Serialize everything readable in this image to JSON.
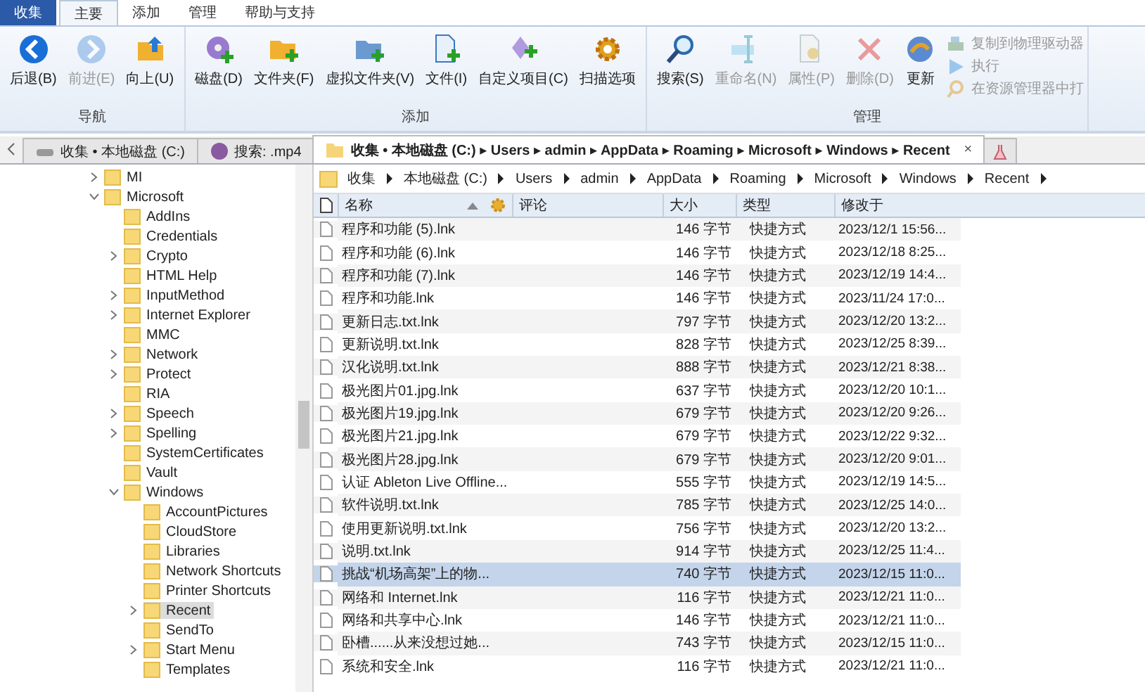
{
  "app_menu": {
    "label": "收集"
  },
  "ribbon_tabs": [
    {
      "label": "主要",
      "selected": true
    },
    {
      "label": "添加",
      "selected": false
    },
    {
      "label": "管理",
      "selected": false
    },
    {
      "label": "帮助与支持",
      "selected": false
    }
  ],
  "ribbon_groups": [
    {
      "label": "导航",
      "buttons": [
        {
          "label": "后退(B)",
          "disabled": false
        },
        {
          "label": "前进(E)",
          "disabled": true
        },
        {
          "label": "向上(U)",
          "disabled": false
        }
      ]
    },
    {
      "label": "添加",
      "buttons": [
        {
          "label": "磁盘(D)",
          "disabled": false
        },
        {
          "label": "文件夹(F)",
          "disabled": false
        },
        {
          "label": "虚拟文件夹(V)",
          "disabled": false
        },
        {
          "label": "文件(I)",
          "disabled": false
        },
        {
          "label": "自定义项目(C)",
          "disabled": false
        },
        {
          "label": "扫描选项",
          "disabled": false
        }
      ]
    },
    {
      "label": "管理",
      "buttons": [
        {
          "label": "搜索(S)",
          "disabled": false
        },
        {
          "label": "重命名(N)",
          "disabled": true
        },
        {
          "label": "属性(P)",
          "disabled": true
        },
        {
          "label": "删除(D)",
          "disabled": true
        },
        {
          "label": "更新",
          "disabled": false
        }
      ],
      "small_buttons": [
        {
          "label": "复制到物理驱动器",
          "disabled": true
        },
        {
          "label": "执行",
          "disabled": true
        },
        {
          "label": "在资源管理器中打",
          "disabled": true
        }
      ]
    }
  ],
  "document_tabs": [
    {
      "label": "收集 • 本地磁盘 (C:)",
      "selected": false
    },
    {
      "label": "搜索: .mp4",
      "selected": false
    },
    {
      "label": "收集 • 本地磁盘 (C:) ▸ Users ▸ admin ▸ AppData ▸ Roaming ▸ Microsoft ▸ Windows ▸ Recent",
      "selected": true,
      "close": "×"
    }
  ],
  "breadcrumb": [
    "收集",
    "本地磁盘 (C:)",
    "Users",
    "admin",
    "AppData",
    "Roaming",
    "Microsoft",
    "Windows",
    "Recent"
  ],
  "tree": [
    {
      "label": "MI",
      "expanded": false,
      "selected": false
    },
    {
      "label": "Microsoft",
      "expanded": true,
      "selected": false,
      "children": [
        {
          "label": "AddIns",
          "selected": false
        },
        {
          "label": "Credentials",
          "selected": false
        },
        {
          "label": "Crypto",
          "expanded": false,
          "selected": false
        },
        {
          "label": "HTML Help",
          "selected": false
        },
        {
          "label": "InputMethod",
          "expanded": false,
          "selected": false
        },
        {
          "label": "Internet Explorer",
          "expanded": false,
          "selected": false
        },
        {
          "label": "MMC",
          "selected": false
        },
        {
          "label": "Network",
          "expanded": false,
          "selected": false
        },
        {
          "label": "Protect",
          "expanded": false,
          "selected": false
        },
        {
          "label": "RIA",
          "selected": false
        },
        {
          "label": "Speech",
          "expanded": false,
          "selected": false
        },
        {
          "label": "Spelling",
          "expanded": false,
          "selected": false
        },
        {
          "label": "SystemCertificates",
          "selected": false
        },
        {
          "label": "Vault",
          "selected": false
        },
        {
          "label": "Windows",
          "expanded": true,
          "selected": false,
          "children": [
            {
              "label": "AccountPictures",
              "selected": false
            },
            {
              "label": "CloudStore",
              "selected": false
            },
            {
              "label": "Libraries",
              "selected": false
            },
            {
              "label": "Network Shortcuts",
              "selected": false
            },
            {
              "label": "Printer Shortcuts",
              "selected": false
            },
            {
              "label": "Recent",
              "expanded": false,
              "selected": true
            },
            {
              "label": "SendTo",
              "selected": false
            },
            {
              "label": "Start Menu",
              "expanded": false,
              "selected": false
            },
            {
              "label": "Templates",
              "selected": false
            }
          ]
        }
      ]
    }
  ],
  "file_list": {
    "columns": [
      {
        "label": "名称",
        "sorted": true
      },
      {
        "label": "评论",
        "sorted": false
      },
      {
        "label": "大小",
        "sorted": false
      },
      {
        "label": "类型",
        "sorted": false
      },
      {
        "label": "修改于",
        "sorted": false
      }
    ],
    "rows": [
      {
        "name": "程序和功能 (5).lnk",
        "size": "146 字节",
        "type": "快捷方式",
        "modified": "2023/12/1 15:56...",
        "selected": false
      },
      {
        "name": "程序和功能 (6).lnk",
        "size": "146 字节",
        "type": "快捷方式",
        "modified": "2023/12/18 8:25...",
        "selected": false
      },
      {
        "name": "程序和功能 (7).lnk",
        "size": "146 字节",
        "type": "快捷方式",
        "modified": "2023/12/19 14:4...",
        "selected": false
      },
      {
        "name": "程序和功能.lnk",
        "size": "146 字节",
        "type": "快捷方式",
        "modified": "2023/11/24 17:0...",
        "selected": false
      },
      {
        "name": "更新日志.txt.lnk",
        "size": "797 字节",
        "type": "快捷方式",
        "modified": "2023/12/20 13:2...",
        "selected": false
      },
      {
        "name": "更新说明.txt.lnk",
        "size": "828 字节",
        "type": "快捷方式",
        "modified": "2023/12/25 8:39...",
        "selected": false
      },
      {
        "name": "汉化说明.txt.lnk",
        "size": "888 字节",
        "type": "快捷方式",
        "modified": "2023/12/21 8:38...",
        "selected": false
      },
      {
        "name": "极光图片01.jpg.lnk",
        "size": "637 字节",
        "type": "快捷方式",
        "modified": "2023/12/20 10:1...",
        "selected": false
      },
      {
        "name": "极光图片19.jpg.lnk",
        "size": "679 字节",
        "type": "快捷方式",
        "modified": "2023/12/20 9:26...",
        "selected": false
      },
      {
        "name": "极光图片21.jpg.lnk",
        "size": "679 字节",
        "type": "快捷方式",
        "modified": "2023/12/22 9:32...",
        "selected": false
      },
      {
        "name": "极光图片28.jpg.lnk",
        "size": "679 字节",
        "type": "快捷方式",
        "modified": "2023/12/20 9:01...",
        "selected": false
      },
      {
        "name": "认证 Ableton Live Offline...",
        "size": "555 字节",
        "type": "快捷方式",
        "modified": "2023/12/19 14:5...",
        "selected": false
      },
      {
        "name": "软件说明.txt.lnk",
        "size": "785 字节",
        "type": "快捷方式",
        "modified": "2023/12/25 14:0...",
        "selected": false
      },
      {
        "name": "使用更新说明.txt.lnk",
        "size": "756 字节",
        "type": "快捷方式",
        "modified": "2023/12/20 13:2...",
        "selected": false
      },
      {
        "name": "说明.txt.lnk",
        "size": "914 字节",
        "type": "快捷方式",
        "modified": "2023/12/25 11:4...",
        "selected": false
      },
      {
        "name": "挑战“机场高架”上的物...",
        "size": "740 字节",
        "type": "快捷方式",
        "modified": "2023/12/15 11:0...",
        "selected": true
      },
      {
        "name": "网络和 Internet.lnk",
        "size": "116 字节",
        "type": "快捷方式",
        "modified": "2023/12/21 11:0...",
        "selected": false
      },
      {
        "name": "网络和共享中心.lnk",
        "size": "146 字节",
        "type": "快捷方式",
        "modified": "2023/12/21 11:0...",
        "selected": false
      },
      {
        "name": "卧槽......从来没想过她...",
        "size": "743 字节",
        "type": "快捷方式",
        "modified": "2023/12/15 11:0...",
        "selected": false
      },
      {
        "name": "系统和安全.lnk",
        "size": "116 字节",
        "type": "快捷方式",
        "modified": "2023/12/21 11:0...",
        "selected": false
      }
    ]
  }
}
